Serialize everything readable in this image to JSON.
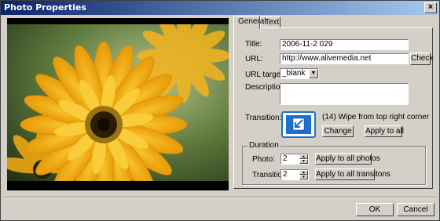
{
  "window": {
    "title": "Photo Properties",
    "close": "×"
  },
  "tabs": [
    {
      "label": "General"
    },
    {
      "label": "Text"
    }
  ],
  "general": {
    "title_label": "Title:",
    "title_value": "2006-11-2 029",
    "url_label": "URL:",
    "url_value": "http://www.alivemedia.net",
    "check_button": "Check",
    "url_target_label": "URL target:",
    "url_target_value": "_blank",
    "description_label": "Description:",
    "description_value": "",
    "transition_label": "Transition:",
    "transition_name": "(14) Wipe from top right corner",
    "change_button": "Change",
    "apply_all_button": "Apply to all"
  },
  "duration": {
    "group_label": "Duration",
    "photo_label": "Photo:",
    "photo_value": "2",
    "transition_label": "Transition:",
    "transition_value": "2",
    "apply_photos_button": "Apply to all photos",
    "apply_transitions_button": "Apply to all transitons"
  },
  "footer": {
    "ok": "OK",
    "cancel": "Cancel"
  },
  "colors": {
    "titlebar_start": "#0a246a",
    "titlebar_end": "#a6caf0",
    "face": "#d4d0c8",
    "transition_icon": "#1e6fd0"
  }
}
